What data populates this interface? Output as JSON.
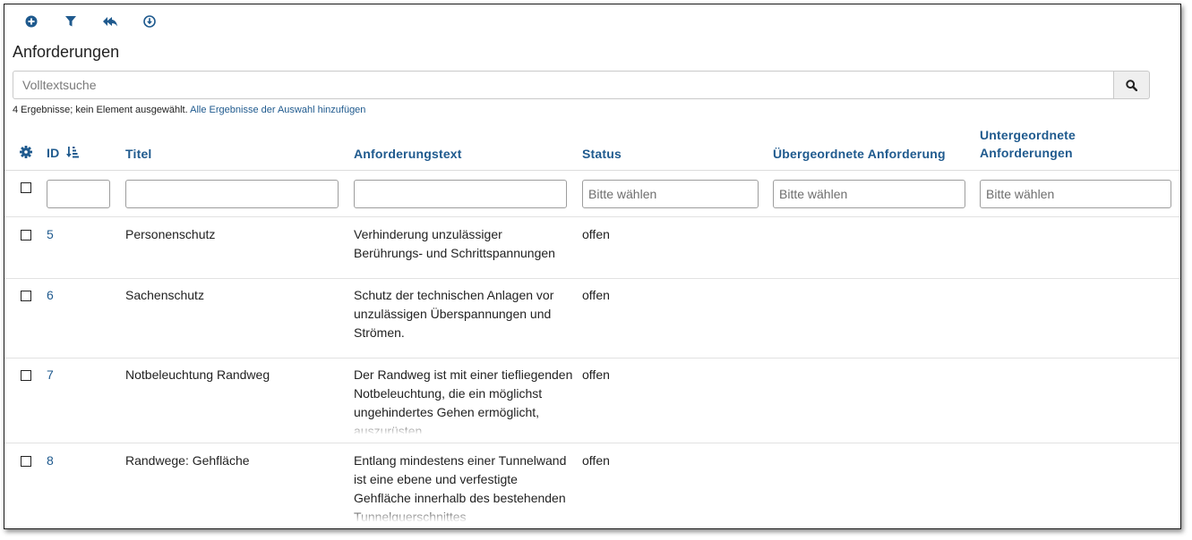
{
  "toolbar": {
    "icons": [
      "add-circle-icon",
      "filter-icon",
      "reply-all-icon",
      "download-circle-icon"
    ],
    "accent": "#1f5a8e"
  },
  "page_title": "Anforderungen",
  "search": {
    "placeholder": "Volltextsuche",
    "value": ""
  },
  "result_info": {
    "text": "4 Ergebnisse; kein Element ausgewählt.",
    "link": "Alle Ergebnisse der Auswahl hinzufügen"
  },
  "columns": {
    "id": "ID",
    "titel": "Titel",
    "text": "Anforderungstext",
    "status": "Status",
    "parent": "Übergeordnete Anforderung",
    "children_line1": "Untergeordnete",
    "children_line2": "Anforderungen"
  },
  "filters": {
    "status_placeholder": "Bitte wählen",
    "parent_placeholder": "Bitte wählen",
    "children_placeholder": "Bitte wählen"
  },
  "rows": [
    {
      "id": "5",
      "titel": "Personenschutz",
      "text": "Verhinderung unzulässiger Berührungs- und Schrittspannungen",
      "status": "offen"
    },
    {
      "id": "6",
      "titel": "Sachenschutz",
      "text": "Schutz der technischen Anlagen vor unzulässigen Überspannungen und Strömen.",
      "status": "offen"
    },
    {
      "id": "7",
      "titel": "Notbeleuchtung Randweg",
      "text": "Der Randweg ist mit einer tiefliegenden Notbeleuchtung, die ein möglichst ungehindertes Gehen ermöglicht, auszurüsten",
      "status": "offen"
    },
    {
      "id": "8",
      "titel": "Randwege: Gehfläche",
      "text": "Entlang mindestens einer Tunnelwand ist eine ebene und verfestigte Gehfläche innerhalb des bestehenden Tunnelquerschnittes",
      "status": "offen"
    }
  ]
}
